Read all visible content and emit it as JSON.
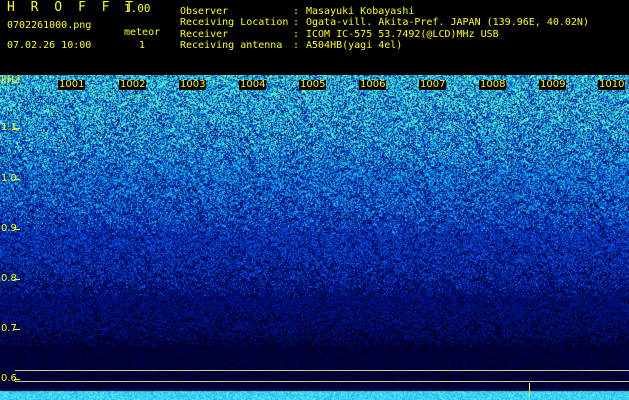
{
  "header": {
    "app_title": "H R O F F T",
    "version": "1.00",
    "filename": "0702261000.png",
    "datetime": "07.02.26 10:00",
    "meteor_label": "meteor",
    "meteor_count": "1",
    "info": [
      {
        "label": "Observer",
        "colon": ":",
        "value": "Masayuki Kobayashi"
      },
      {
        "label": "Receiving Location",
        "colon": ":",
        "value": "Ogata-vill. Akita-Pref. JAPAN (139.96E, 40.02N)"
      },
      {
        "label": "Receiver",
        "colon": ":",
        "value": "ICOM IC-575 53.7492(@LCD)MHz USB"
      },
      {
        "label": "Receiving antenna",
        "colon": ":",
        "value": "A504HB(yagi 4el)"
      }
    ]
  },
  "spectrogram": {
    "unit_label": "kHz",
    "freq_labels": [
      "1.1",
      "1.0",
      "0.9",
      "0.8",
      "0.7",
      "0.6"
    ],
    "time_labels": [
      "1001",
      "1002",
      "1003",
      "1004",
      "1005",
      "1006",
      "1007",
      "1008",
      "1009",
      "1010"
    ],
    "colors": {
      "label": "#ffff00",
      "ref_line": "#d8c890",
      "baseline": "#00e0ff"
    }
  }
}
